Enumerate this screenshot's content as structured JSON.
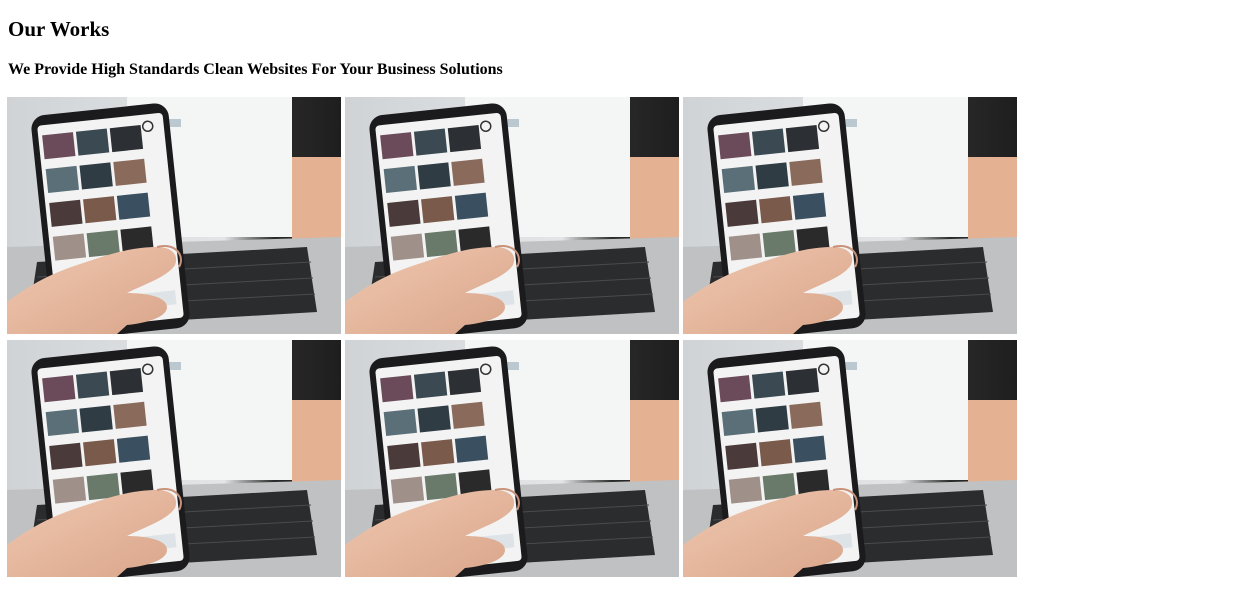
{
  "header": {
    "title": "Our Works",
    "subtitle": "We Provide High Standards Clean Websites For Your Business Solutions"
  },
  "gallery": {
    "items": [
      {
        "icon": "phone-photo"
      },
      {
        "icon": "phone-photo"
      },
      {
        "icon": "phone-photo"
      },
      {
        "icon": "phone-photo"
      },
      {
        "icon": "phone-photo"
      },
      {
        "icon": "phone-photo"
      }
    ]
  }
}
